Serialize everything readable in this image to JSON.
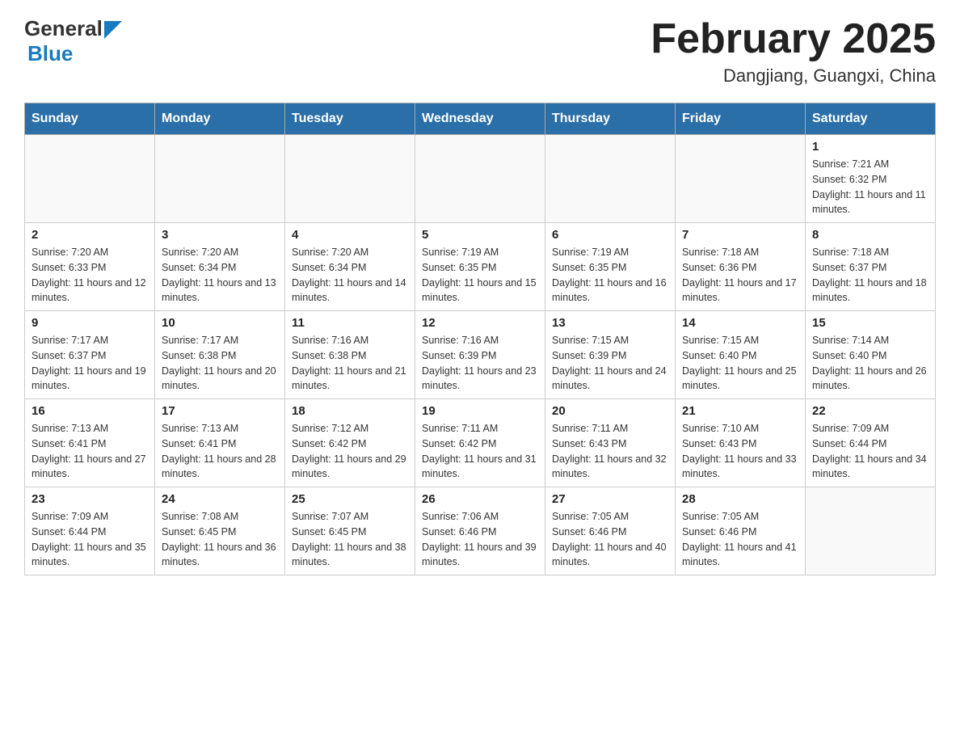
{
  "header": {
    "title": "February 2025",
    "subtitle": "Dangjiang, Guangxi, China"
  },
  "days_of_week": [
    "Sunday",
    "Monday",
    "Tuesday",
    "Wednesday",
    "Thursday",
    "Friday",
    "Saturday"
  ],
  "weeks": [
    [
      {
        "day": "",
        "info": ""
      },
      {
        "day": "",
        "info": ""
      },
      {
        "day": "",
        "info": ""
      },
      {
        "day": "",
        "info": ""
      },
      {
        "day": "",
        "info": ""
      },
      {
        "day": "",
        "info": ""
      },
      {
        "day": "1",
        "info": "Sunrise: 7:21 AM\nSunset: 6:32 PM\nDaylight: 11 hours and 11 minutes."
      }
    ],
    [
      {
        "day": "2",
        "info": "Sunrise: 7:20 AM\nSunset: 6:33 PM\nDaylight: 11 hours and 12 minutes."
      },
      {
        "day": "3",
        "info": "Sunrise: 7:20 AM\nSunset: 6:34 PM\nDaylight: 11 hours and 13 minutes."
      },
      {
        "day": "4",
        "info": "Sunrise: 7:20 AM\nSunset: 6:34 PM\nDaylight: 11 hours and 14 minutes."
      },
      {
        "day": "5",
        "info": "Sunrise: 7:19 AM\nSunset: 6:35 PM\nDaylight: 11 hours and 15 minutes."
      },
      {
        "day": "6",
        "info": "Sunrise: 7:19 AM\nSunset: 6:35 PM\nDaylight: 11 hours and 16 minutes."
      },
      {
        "day": "7",
        "info": "Sunrise: 7:18 AM\nSunset: 6:36 PM\nDaylight: 11 hours and 17 minutes."
      },
      {
        "day": "8",
        "info": "Sunrise: 7:18 AM\nSunset: 6:37 PM\nDaylight: 11 hours and 18 minutes."
      }
    ],
    [
      {
        "day": "9",
        "info": "Sunrise: 7:17 AM\nSunset: 6:37 PM\nDaylight: 11 hours and 19 minutes."
      },
      {
        "day": "10",
        "info": "Sunrise: 7:17 AM\nSunset: 6:38 PM\nDaylight: 11 hours and 20 minutes."
      },
      {
        "day": "11",
        "info": "Sunrise: 7:16 AM\nSunset: 6:38 PM\nDaylight: 11 hours and 21 minutes."
      },
      {
        "day": "12",
        "info": "Sunrise: 7:16 AM\nSunset: 6:39 PM\nDaylight: 11 hours and 23 minutes."
      },
      {
        "day": "13",
        "info": "Sunrise: 7:15 AM\nSunset: 6:39 PM\nDaylight: 11 hours and 24 minutes."
      },
      {
        "day": "14",
        "info": "Sunrise: 7:15 AM\nSunset: 6:40 PM\nDaylight: 11 hours and 25 minutes."
      },
      {
        "day": "15",
        "info": "Sunrise: 7:14 AM\nSunset: 6:40 PM\nDaylight: 11 hours and 26 minutes."
      }
    ],
    [
      {
        "day": "16",
        "info": "Sunrise: 7:13 AM\nSunset: 6:41 PM\nDaylight: 11 hours and 27 minutes."
      },
      {
        "day": "17",
        "info": "Sunrise: 7:13 AM\nSunset: 6:41 PM\nDaylight: 11 hours and 28 minutes."
      },
      {
        "day": "18",
        "info": "Sunrise: 7:12 AM\nSunset: 6:42 PM\nDaylight: 11 hours and 29 minutes."
      },
      {
        "day": "19",
        "info": "Sunrise: 7:11 AM\nSunset: 6:42 PM\nDaylight: 11 hours and 31 minutes."
      },
      {
        "day": "20",
        "info": "Sunrise: 7:11 AM\nSunset: 6:43 PM\nDaylight: 11 hours and 32 minutes."
      },
      {
        "day": "21",
        "info": "Sunrise: 7:10 AM\nSunset: 6:43 PM\nDaylight: 11 hours and 33 minutes."
      },
      {
        "day": "22",
        "info": "Sunrise: 7:09 AM\nSunset: 6:44 PM\nDaylight: 11 hours and 34 minutes."
      }
    ],
    [
      {
        "day": "23",
        "info": "Sunrise: 7:09 AM\nSunset: 6:44 PM\nDaylight: 11 hours and 35 minutes."
      },
      {
        "day": "24",
        "info": "Sunrise: 7:08 AM\nSunset: 6:45 PM\nDaylight: 11 hours and 36 minutes."
      },
      {
        "day": "25",
        "info": "Sunrise: 7:07 AM\nSunset: 6:45 PM\nDaylight: 11 hours and 38 minutes."
      },
      {
        "day": "26",
        "info": "Sunrise: 7:06 AM\nSunset: 6:46 PM\nDaylight: 11 hours and 39 minutes."
      },
      {
        "day": "27",
        "info": "Sunrise: 7:05 AM\nSunset: 6:46 PM\nDaylight: 11 hours and 40 minutes."
      },
      {
        "day": "28",
        "info": "Sunrise: 7:05 AM\nSunset: 6:46 PM\nDaylight: 11 hours and 41 minutes."
      },
      {
        "day": "",
        "info": ""
      }
    ]
  ]
}
